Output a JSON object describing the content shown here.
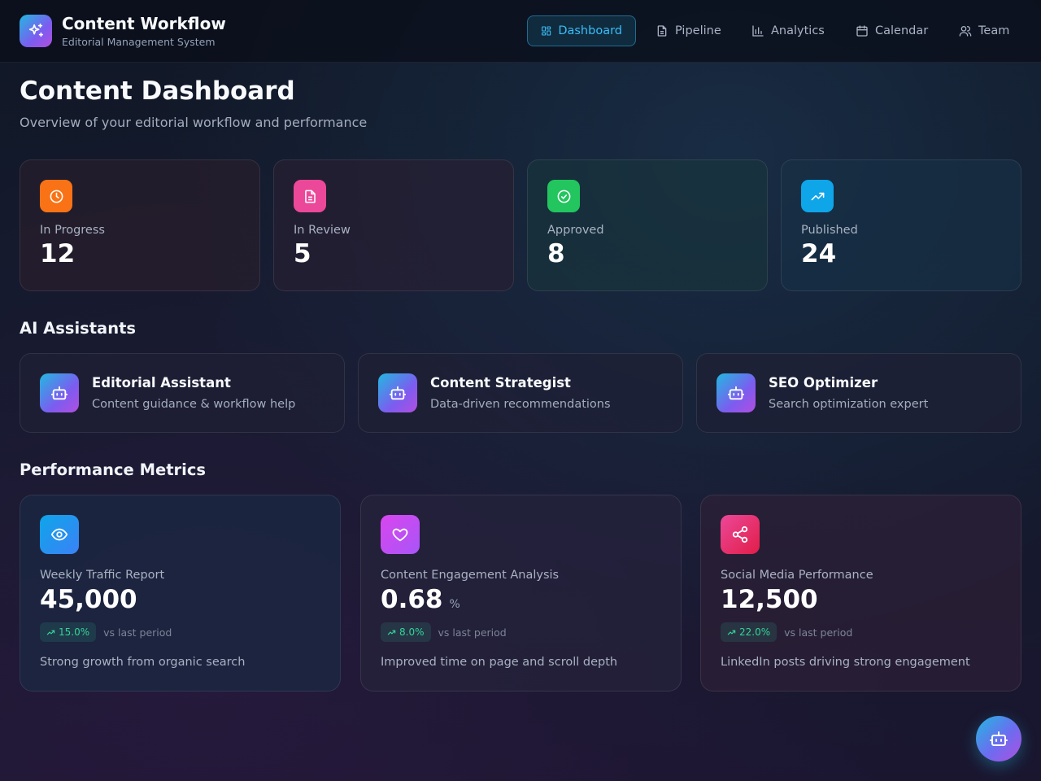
{
  "header": {
    "title": "Content Workflow",
    "subtitle": "Editorial Management System",
    "logo_icon": "sparkles-icon"
  },
  "nav": {
    "active": "Dashboard",
    "items": [
      {
        "label": "Dashboard",
        "icon": "dashboard-grid-icon"
      },
      {
        "label": "Pipeline",
        "icon": "document-icon"
      },
      {
        "label": "Analytics",
        "icon": "bar-chart-icon"
      },
      {
        "label": "Calendar",
        "icon": "calendar-icon"
      },
      {
        "label": "Team",
        "icon": "users-icon"
      }
    ]
  },
  "page": {
    "title": "Content Dashboard",
    "subtitle": "Overview of your editorial workflow and performance"
  },
  "stats": [
    {
      "label": "In Progress",
      "value": "12",
      "icon": "clock-icon",
      "color": "#f97316"
    },
    {
      "label": "In Review",
      "value": "5",
      "icon": "document-icon",
      "color": "#ec4899"
    },
    {
      "label": "Approved",
      "value": "8",
      "icon": "check-circle-icon",
      "color": "#22c55e"
    },
    {
      "label": "Published",
      "value": "24",
      "icon": "trending-up-icon",
      "color": "#0ea5e9"
    }
  ],
  "assistants": {
    "title": "AI Assistants",
    "items": [
      {
        "name": "Editorial Assistant",
        "description": "Content guidance & workflow help",
        "icon": "bot-icon"
      },
      {
        "name": "Content Strategist",
        "description": "Data-driven recommendations",
        "icon": "bot-icon"
      },
      {
        "name": "SEO Optimizer",
        "description": "Search optimization expert",
        "icon": "bot-icon"
      }
    ]
  },
  "metrics": {
    "title": "Performance Metrics",
    "items": [
      {
        "name": "Weekly Traffic Report",
        "value": "45,000",
        "unit": "",
        "change": "15.0%",
        "change_caption": "vs last period",
        "note": "Strong growth from organic search",
        "icon": "eye-icon",
        "color": "#0ea5e9"
      },
      {
        "name": "Content Engagement Analysis",
        "value": "0.68",
        "unit": "%",
        "change": "8.0%",
        "change_caption": "vs last period",
        "note": "Improved time on page and scroll depth",
        "icon": "heart-icon",
        "color": "#c026d3"
      },
      {
        "name": "Social Media Performance",
        "value": "12,500",
        "unit": "",
        "change": "22.0%",
        "change_caption": "vs last period",
        "note": "LinkedIn posts driving strong engagement",
        "icon": "share-icon",
        "color": "#ec4899"
      }
    ]
  },
  "fab": {
    "icon": "bot-icon"
  },
  "colors": {
    "accent": "#38bdf8",
    "positive": "#34d399",
    "background": "#111827"
  }
}
